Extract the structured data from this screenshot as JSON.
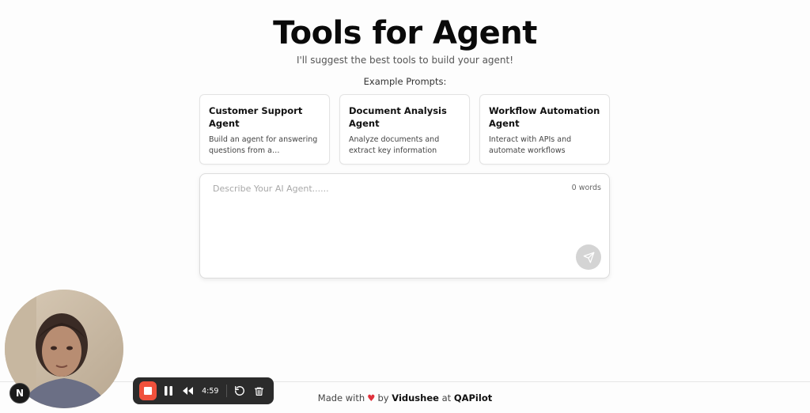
{
  "header": {
    "title": "Tools for Agent",
    "subtitle": "I'll suggest the best tools to build your agent!"
  },
  "examples": {
    "label": "Example Prompts:",
    "cards": [
      {
        "title": "Customer Support Agent",
        "description": "Build an agent for answering questions from a knowledge..."
      },
      {
        "title": "Document Analysis Agent",
        "description": "Analyze documents and extract key information"
      },
      {
        "title": "Workflow Automation Agent",
        "description": "Interact with APIs and automate workflows"
      }
    ]
  },
  "prompt": {
    "placeholder": "Describe Your AI Agent......",
    "value": "",
    "word_count": "0 words"
  },
  "footer": {
    "prefix": "Made with",
    "by": "by",
    "author": "Vidushee",
    "at": "at",
    "company": "QAPilot"
  },
  "badge": {
    "letter": "N"
  },
  "recorder": {
    "time": "4:59"
  },
  "colors": {
    "heart": "#e0323c",
    "stop_button": "#f0513c",
    "send_button": "#d4d4d4",
    "recorder_bg": "#2b2b2b"
  },
  "icons": {
    "send": "send-icon",
    "stop": "stop-icon",
    "pause": "pause-icon",
    "rewind": "rewind-icon",
    "restart": "restart-icon",
    "delete": "trash-icon",
    "heart": "heart-icon"
  }
}
